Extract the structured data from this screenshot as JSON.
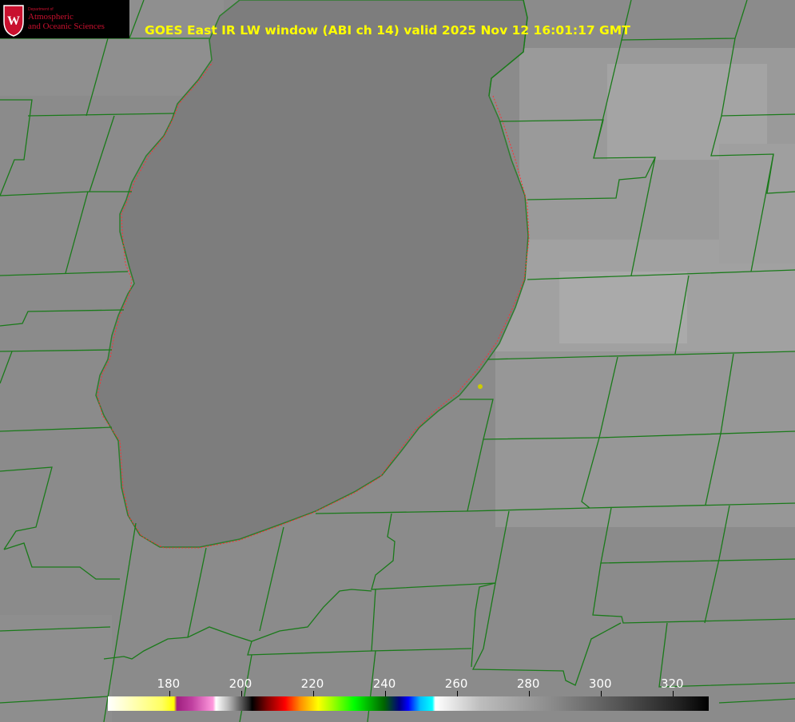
{
  "logo": {
    "department_small": "Department of",
    "line1": "Atmospheric",
    "line2": "and Oceanic Sciences"
  },
  "title": "GOES East IR LW window (ABI ch 14) valid 2025 Nov 12 16:01:17 GMT",
  "colorbar": {
    "ticks": [
      "180",
      "200",
      "220",
      "240",
      "260",
      "280",
      "300",
      "320"
    ],
    "range": [
      163,
      330
    ]
  },
  "colors": {
    "boundaries": "#1a7a1a",
    "coastline_overlay": "#ff3030",
    "title_text": "#ffff00",
    "marker": "#cccc00"
  },
  "map": {
    "feature": "lake",
    "marker": "station-dot"
  }
}
